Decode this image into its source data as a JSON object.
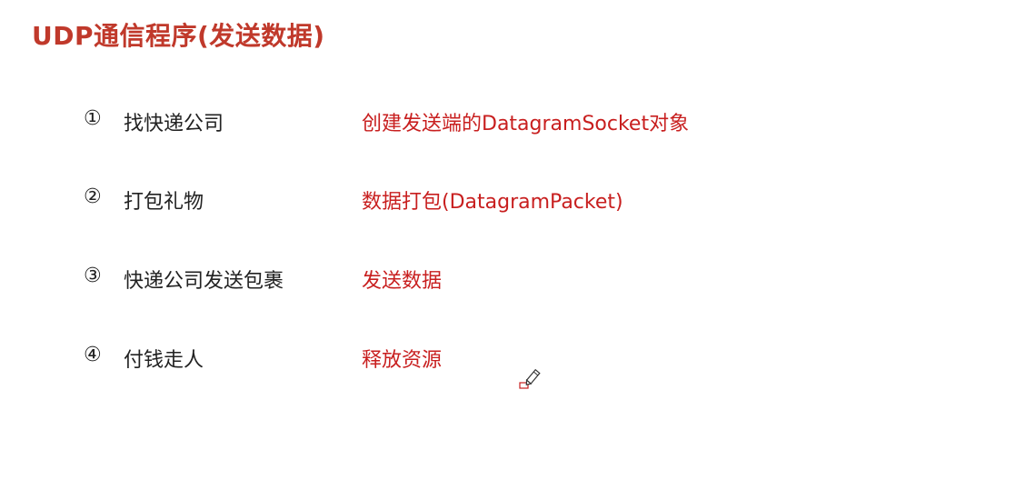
{
  "title": "UDP通信程序(发送数据)",
  "steps": [
    {
      "number": "①",
      "analogy": "找快递公司",
      "action": "创建发送端的DatagramSocket对象"
    },
    {
      "number": "②",
      "analogy": "打包礼物",
      "action": "数据打包(DatagramPacket)"
    },
    {
      "number": "③",
      "analogy": "快递公司发送包裹",
      "action": "发送数据"
    },
    {
      "number": "④",
      "analogy": "付钱走人",
      "action": "释放资源"
    }
  ],
  "colors": {
    "title": "#c0392b",
    "action": "#c81f1f",
    "text": "#222222"
  },
  "cursor_icon": "pen-cursor-icon"
}
